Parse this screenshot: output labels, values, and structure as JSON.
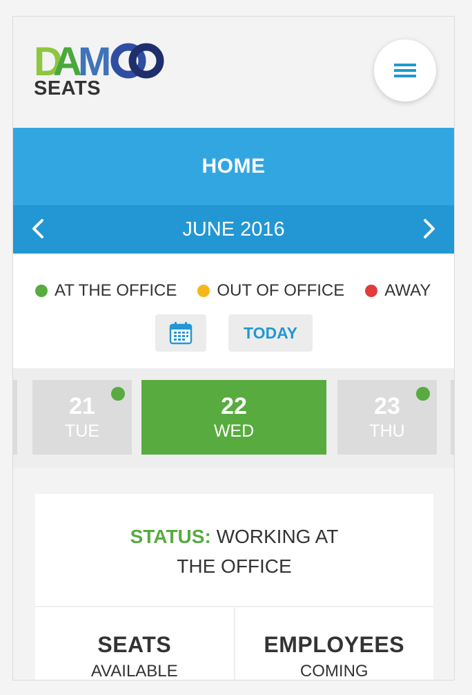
{
  "header": {
    "logo_text": "DAMCO",
    "logo_subtitle": "SEATS"
  },
  "page": {
    "title": "HOME",
    "month": "JUNE 2016"
  },
  "legend": [
    {
      "label": "AT THE OFFICE",
      "color": "#57ab3f"
    },
    {
      "label": "OUT OF OFFICE",
      "color": "#f4b81b"
    },
    {
      "label": "AWAY",
      "color": "#e03c3c"
    }
  ],
  "controls": {
    "today_label": "TODAY",
    "calendar_icon": "calendar-icon"
  },
  "days": [
    {
      "num": "21",
      "weekday": "TUE",
      "active": false,
      "status_color": "#57ab3f"
    },
    {
      "num": "22",
      "weekday": "WED",
      "active": true
    },
    {
      "num": "23",
      "weekday": "THU",
      "active": false,
      "status_color": "#57ab3f"
    }
  ],
  "status": {
    "label": "STATUS:",
    "value_line1": "WORKING AT",
    "value_line2": "THE OFFICE"
  },
  "stats": [
    {
      "title": "SEATS",
      "subtitle": "AVAILABLE"
    },
    {
      "title": "EMPLOYEES",
      "subtitle": "COMING"
    }
  ],
  "colors": {
    "primary": "#32a6e1",
    "primary_dark": "#2297d3",
    "green": "#57ab3f"
  }
}
